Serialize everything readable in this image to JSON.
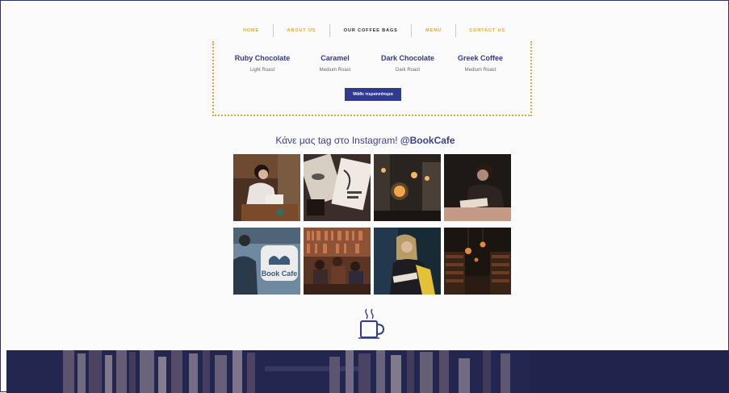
{
  "nav": {
    "items": [
      {
        "label": "HOME",
        "active": false
      },
      {
        "label": "ABOUT US",
        "active": false
      },
      {
        "label": "OUR COFFEE BAGS",
        "active": true
      },
      {
        "label": "MENU",
        "active": false
      },
      {
        "label": "CONTACT US",
        "active": false
      }
    ]
  },
  "coffees": [
    {
      "name": "Ruby Chocolate",
      "roast": "Light Roast"
    },
    {
      "name": "Caramel",
      "roast": "Medium Roast"
    },
    {
      "name": "Dark Chocolate",
      "roast": "Dark Roast"
    },
    {
      "name": "Greek Coffee",
      "roast": "Medium Roast"
    }
  ],
  "cta_label": "Μάθε περισσότερα",
  "instagram": {
    "title": "Κάνε μας tag στο Instagram!",
    "handle": "@BookCafe"
  },
  "photos": [
    {
      "subject": "woman reading at café table",
      "colors": [
        "#5a3a24",
        "#c9c0b8"
      ]
    },
    {
      "subject": "magazines with coffee",
      "colors": [
        "#3b2e28",
        "#e8e2da"
      ]
    },
    {
      "subject": "hanging edison bulbs",
      "colors": [
        "#2a2420",
        "#f2a64a"
      ]
    },
    {
      "subject": "person reading a book",
      "colors": [
        "#1e1816",
        "#b9968a"
      ]
    },
    {
      "subject": "Book Cafe sign",
      "colors": [
        "#5d7a90",
        "#e6e6e6"
      ]
    },
    {
      "subject": "people in bookstore café",
      "colors": [
        "#4a2c22",
        "#b66b4b"
      ]
    },
    {
      "subject": "woman with yellow jacket reading",
      "colors": [
        "#182a36",
        "#e3c23a"
      ]
    },
    {
      "subject": "library shelves with lamps",
      "colors": [
        "#1b1512",
        "#d2783a"
      ]
    }
  ],
  "photo_overlay_text": "Book Cafe",
  "colors": {
    "accent": "#f0a324",
    "brand": "#303a8e",
    "footer": "#23264f"
  },
  "icons": {
    "footer_logo": "coffee-cup-icon"
  }
}
